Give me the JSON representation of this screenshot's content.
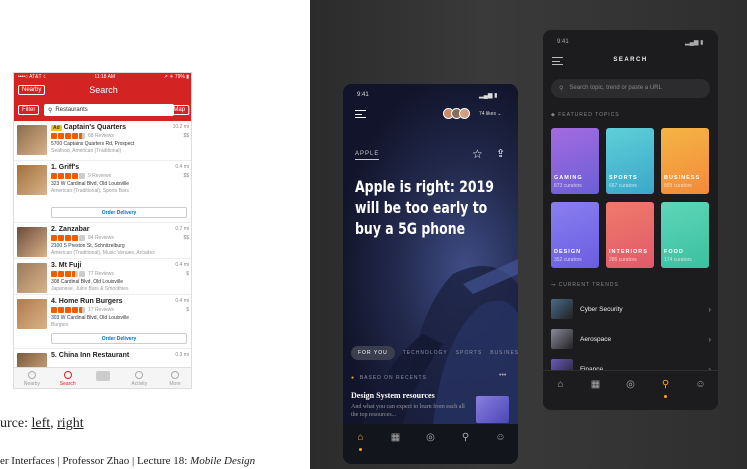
{
  "yelp": {
    "status": {
      "carrier": "••••○ AT&T ☇",
      "time": "11:18 AM",
      "battery": "↗ ✳ 79% ▮"
    },
    "nearby": "Nearby",
    "title": "Search",
    "filter": "Filter",
    "query": "Restaurants",
    "map": "Map",
    "items": [
      {
        "name": "Captain's Quarters",
        "ad": "Ad",
        "dist": "10.2 mi",
        "price": "$$",
        "reviews": "68 Reviews",
        "address": "5700 Captains Quarters Rd, Prospect",
        "category": "Seafood, American (Traditional)",
        "stars": [
          1,
          1,
          1,
          1,
          0.5
        ],
        "img": "#8a6b4a"
      },
      {
        "name": "1. Griff's",
        "dist": "0.4 mi",
        "price": "$$",
        "reviews": "9 Reviews",
        "address": "323 W Cardinal Blvd, Old Louisville",
        "category": "American (Traditional), Sports Bars",
        "stars": [
          1,
          1,
          1,
          1,
          0
        ],
        "img": "#a0703c",
        "delivery": "Order Delivery"
      },
      {
        "name": "2. Zanzabar",
        "dist": "0.7 mi",
        "price": "$$",
        "reviews": "84 Reviews",
        "address": "2100 S Preston St, Schnitzelburg",
        "category": "American (Traditional), Music Venues, Arcades",
        "stars": [
          1,
          1,
          1,
          1,
          0
        ],
        "img": "#6b4a3a"
      },
      {
        "name": "3. Mt Fuji",
        "dist": "0.4 mi",
        "price": "$",
        "reviews": "77 Reviews",
        "address": "308 Cardinal Blvd, Old Louisville",
        "category": "Japanese, Juice Bars & Smoothies",
        "stars": [
          1,
          1,
          1,
          0.5,
          0
        ],
        "img": "#9a7a5a"
      },
      {
        "name": "4. Home Run Burgers",
        "dist": "0.4 mi",
        "price": "$",
        "reviews": "17 Reviews",
        "address": "303 W Cardinal Blvd, Old Louisville",
        "category": "Burgers",
        "stars": [
          1,
          1,
          1,
          1,
          0.5
        ],
        "img": "#b07a4a",
        "delivery": "Order Delivery"
      },
      {
        "name": "5. China Inn Restaurant",
        "dist": "0.3 mi",
        "price": "",
        "reviews": "",
        "address": "",
        "category": "",
        "stars": [],
        "img": "#7a5a3a"
      }
    ],
    "tabs": [
      "Nearby",
      "Search",
      "",
      "Activity",
      "More"
    ]
  },
  "caption": {
    "prefix": "urce: ",
    "left": "left",
    "sep": ", ",
    "right": "right"
  },
  "footer": {
    "text": "er Interfaces | Professor Zhao | Lecture 18: ",
    "italic": "Mobile Design"
  },
  "phone1": {
    "time": "9:41",
    "signal": "▂▄▆ ▮",
    "likes": "74 likes ⌄",
    "category": "APPLE",
    "title": "Apple is right: 2019 will be too early to buy a 5G phone",
    "pills": [
      "FOR YOU",
      "TECHNOLOGY",
      "SPORTS",
      "BUSINESS"
    ],
    "based": "BASED ON RECENTS",
    "more": "•••",
    "card_title": "Design System resources",
    "card_desc": "And what you can expect to learn from each all the top resources...",
    "nav": [
      "⌂",
      "▦",
      "◎",
      "⚲",
      "☺"
    ]
  },
  "phone2": {
    "time": "9:41",
    "signal": "▂▄▆ ▮",
    "header": "SEARCH",
    "search_placeholder": "Search topic, trend or paste a URL",
    "featured_label": "FEATURED TOPICS",
    "topics": [
      {
        "name": "GAMING",
        "count": "873 curators",
        "c1": "#6b5fd6",
        "c2": "#a36be0"
      },
      {
        "name": "SPORTS",
        "count": "667 curators",
        "c1": "#3aa7c9",
        "c2": "#5fd0d8"
      },
      {
        "name": "BUSINESS",
        "count": "893 curators",
        "c1": "#f28a3a",
        "c2": "#f5b545"
      },
      {
        "name": "DESIGN",
        "count": "352 curators",
        "c1": "#6a5ee0",
        "c2": "#8a7ef0"
      },
      {
        "name": "INTERIORS",
        "count": "286 curators",
        "c1": "#e05a6a",
        "c2": "#f07a6a"
      },
      {
        "name": "FOOD",
        "count": "174 curators",
        "c1": "#3ac0a0",
        "c2": "#5ed6b8"
      }
    ],
    "trends_label": "CURRENT TRENDS",
    "trends": [
      {
        "name": "Cyber Security",
        "c": "#4a6a8a"
      },
      {
        "name": "Aerospace",
        "c": "#8a8a9a"
      },
      {
        "name": "Finance",
        "c": "#6a5ac0"
      }
    ],
    "nav": [
      "⌂",
      "▦",
      "◎",
      "⚲",
      "☺"
    ]
  }
}
